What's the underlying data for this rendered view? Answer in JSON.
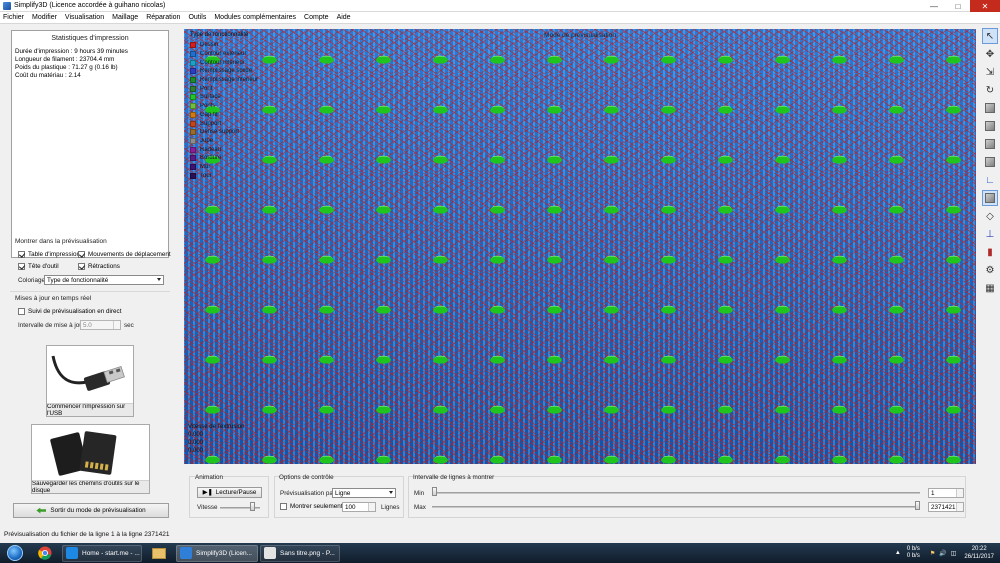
{
  "window": {
    "title": "Simplify3D (Licence accordée à guihano nicolas)"
  },
  "menu": [
    "Fichier",
    "Modifier",
    "Visualisation",
    "Maillage",
    "Réparation",
    "Outils",
    "Modules complémentaires",
    "Compte",
    "Aide"
  ],
  "stats": {
    "header": "Statistiques d'impression",
    "lines": [
      "Durée d'impression : 9 hours 39 minutes",
      "Longueur de filament : 23704.4 mm",
      "Poids du plastique : 71.27 g (0.16 lb)",
      "Coût du matériau : 2.14"
    ]
  },
  "show_preview": {
    "label": "Montrer dans la prévisualisation",
    "checks": [
      {
        "label": "Table d'impression",
        "checked": true
      },
      {
        "label": "Mouvements de déplacement",
        "checked": true
      },
      {
        "label": "Tête d'outil",
        "checked": true
      },
      {
        "label": "Rétractions",
        "checked": true
      }
    ],
    "coloring_label": "Coloriage",
    "coloring_value": "Type de fonctionnalité"
  },
  "realtime": {
    "label": "Mises à jour en temps réel",
    "live_label": "Suivi de prévisualisation en direct",
    "live_checked": false,
    "interval_label": "Intervalle de mise à jour",
    "interval_value": "5.0",
    "interval_unit": "sec"
  },
  "buttons": {
    "usb": "Commencer l'impression sur l'USB",
    "sd": "Sauvegarder les chemins d'outils sur le disque",
    "exit": "Sortir du mode de prévisualisation"
  },
  "viewport": {
    "title": "Mode de prévisualisation",
    "legend_title": "Type de fonctionnalité",
    "legend": [
      {
        "label": "Dessin",
        "color": "#d11f1f"
      },
      {
        "label": "Contour extérieur",
        "color": "#1d6fd1"
      },
      {
        "label": "Contour intérieur",
        "color": "#1aa3c9"
      },
      {
        "label": "Remplissage solide",
        "color": "#2c3ec8"
      },
      {
        "label": "Remplissage intérieur",
        "color": "#1a8c2a"
      },
      {
        "label": "Pont",
        "color": "#2e7d32"
      },
      {
        "label": "Surface",
        "color": "#22c32b"
      },
      {
        "label": "Ponts",
        "color": "#6fbf3f"
      },
      {
        "label": "Gap fill",
        "color": "#cf7a14"
      },
      {
        "label": "Support",
        "color": "#c2451c"
      },
      {
        "label": "Dense support",
        "color": "#9a6c2a"
      },
      {
        "label": "Jupe",
        "color": "#8d8d8d"
      },
      {
        "label": "Radeau",
        "color": "#8a1f9e"
      },
      {
        "label": "Bordure",
        "color": "#5a1a8a"
      },
      {
        "label": "Mur",
        "color": "#3b1475"
      },
      {
        "label": "Tour",
        "color": "#2b0f55"
      }
    ],
    "speed_title": "Vitesse de l'extrusion",
    "speed_lines": [
      "0.000",
      "0.000",
      "0.000"
    ]
  },
  "animation": {
    "label": "Animation",
    "play_label": "Lecture/Pause",
    "speed_label": "Vitesse",
    "speed_fraction": 0.85
  },
  "options": {
    "label": "Options de contrôle",
    "preview_by_label": "Prévisualisation par",
    "preview_by_value": "Ligne",
    "show_only_label": "Montrer seulement",
    "show_only_value": "100",
    "show_only_unit": "Lignes",
    "show_only_checked": false
  },
  "line_range": {
    "label": "Intervalle de lignes à montrer",
    "min_label": "Min",
    "min_value": "1",
    "max_label": "Max",
    "max_value": "2371421",
    "min_fraction": 0.0,
    "max_fraction": 1.0
  },
  "status": "Prévisualisation du fichier de la ligne 1 à la ligne 2371421",
  "taskbar": {
    "tasks": [
      {
        "label": "Home - start.me - ..."
      },
      {
        "label": "Simplify3D (Licen..."
      },
      {
        "label": "Sans titre.png - P..."
      }
    ],
    "net_up": "0 b/s",
    "net_down": "0 b/s",
    "time": "20:22",
    "date": "26/11/2017"
  }
}
